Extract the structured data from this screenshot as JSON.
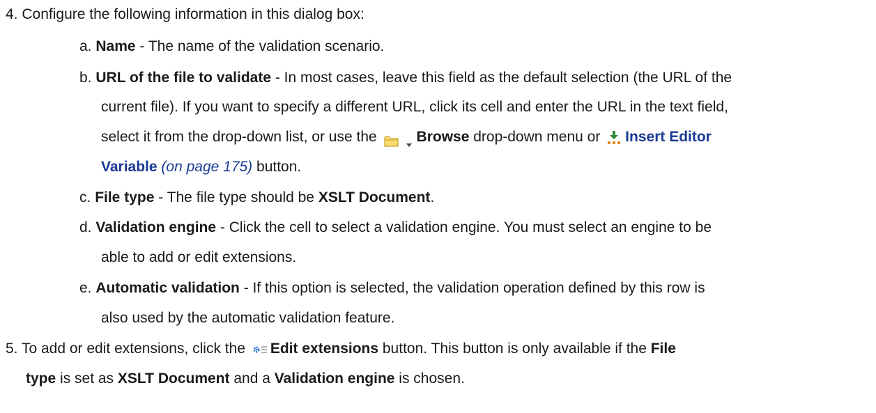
{
  "steps": {
    "s4": {
      "num": "4.",
      "text": "Configure the following information in this dialog box:"
    },
    "a": {
      "letter": "a.",
      "term": "Name",
      "text": " - The name of the validation scenario."
    },
    "b": {
      "letter": "b.",
      "term": "URL of the file to validate",
      "text1": " - In most cases, leave this field as the default selection (the URL of the",
      "text2": "current file). If you want to specify a different URL, click its cell and enter the URL in the text field,",
      "text3": "select it from the drop-down list, or use the",
      "browse": "Browse",
      "text4": " drop-down menu or",
      "insert_link": "Insert Editor",
      "insert_link2": "Variable",
      "xref": "(on page 175)",
      "text5": " button."
    },
    "c": {
      "letter": "c.",
      "term": "File type",
      "text": " - The file type should be ",
      "value": "XSLT Document",
      "end": "."
    },
    "d": {
      "letter": "d.",
      "term": "Validation engine",
      "text1": " - Click the cell to select a validation engine. You must select an engine to be",
      "text2": "able to add or edit extensions."
    },
    "e": {
      "letter": "e.",
      "term": "Automatic validation",
      "text1": " - If this option is selected, the validation operation defined by this row is",
      "text2": "also used by the automatic validation feature."
    },
    "s5": {
      "num": "5.",
      "text1": "To add or edit extensions, click the",
      "button": "Edit extensions",
      "text2": " button. This button is only available if the ",
      "term1": "File",
      "term1b": "type",
      "text3": " is set as ",
      "value": "XSLT Document",
      "text4": " and a ",
      "term2": "Validation engine",
      "text5": " is chosen."
    }
  },
  "icons": {
    "folder": "folder-icon",
    "chevron": "chevron-down-icon",
    "insert": "insert-variable-icon",
    "gear": "edit-extensions-icon"
  },
  "colors": {
    "link": "#1b3a93",
    "text": "#1a1a1a",
    "folder": "#e9c84a",
    "insert_green": "#2e8b2e",
    "insert_orange": "#e08a1e"
  }
}
